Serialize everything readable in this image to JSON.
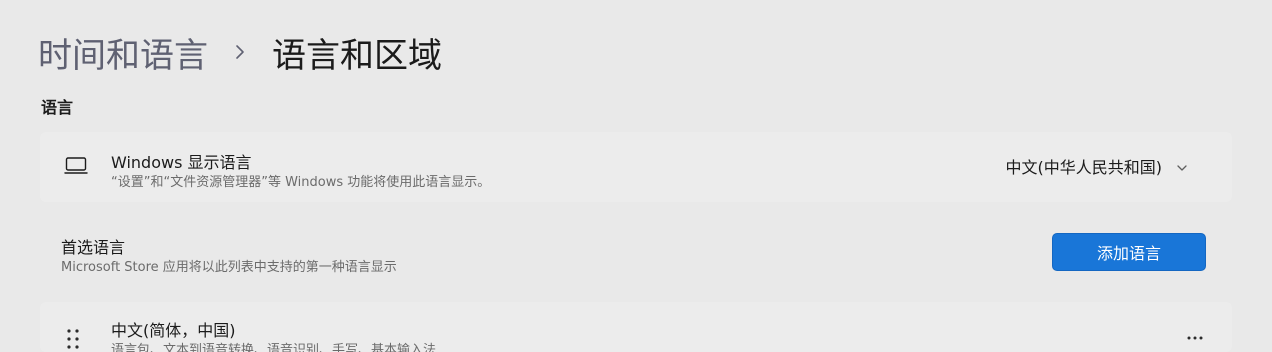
{
  "breadcrumb": {
    "parent": "时间和语言",
    "current": "语言和区域"
  },
  "section": {
    "heading": "语言"
  },
  "display_language": {
    "icon": "laptop-icon",
    "title": "Windows 显示语言",
    "description": "“设置”和“文件资源管理器”等 Windows 功能将使用此语言显示。",
    "selected_value": "中文(中华人民共和国)"
  },
  "preferred_languages": {
    "title": "首选语言",
    "description": "Microsoft Store 应用将以此列表中支持的第一种语言显示",
    "add_button_label": "添加语言"
  },
  "language_list": [
    {
      "name": "中文(简体，中国)",
      "features": "语言包、文本到语音转换、语音识别、手写、基本输入法"
    }
  ],
  "colors": {
    "background": "#e9e9e9",
    "card": "#ececec",
    "accent": "#1976d8"
  }
}
